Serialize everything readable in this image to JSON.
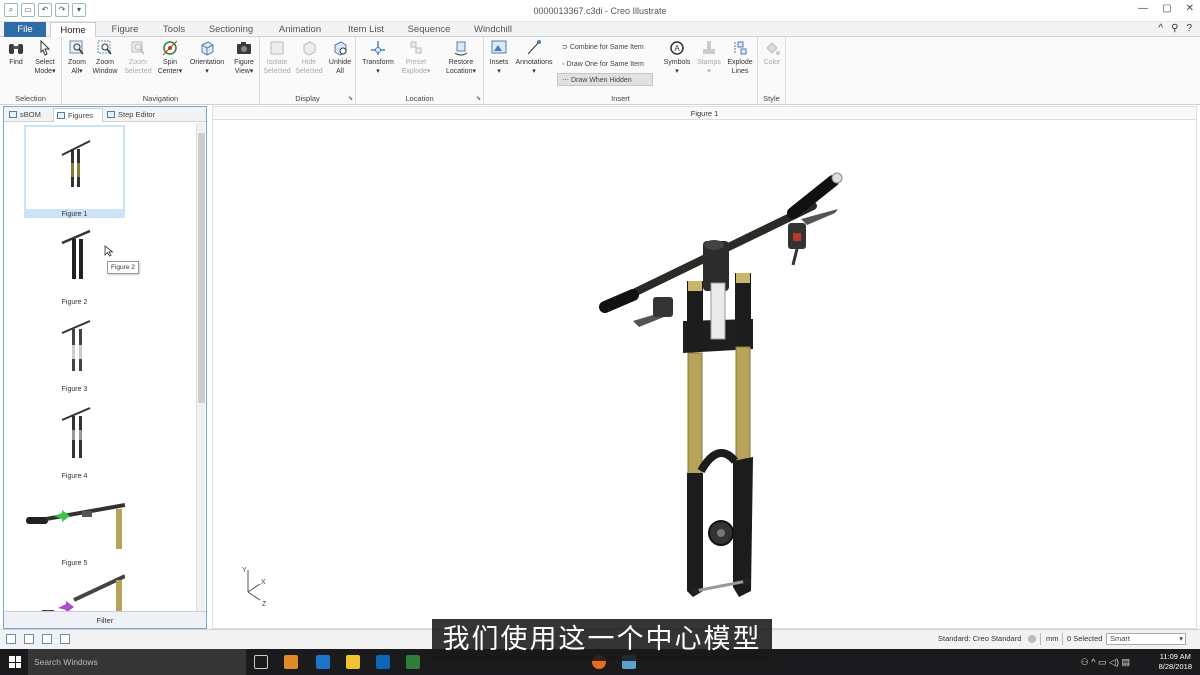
{
  "window": {
    "title": "0000013367.c3di - Creo Illustrate"
  },
  "tabs": [
    "File",
    "Home",
    "Figure",
    "Tools",
    "Sectioning",
    "Animation",
    "Item List",
    "Sequence",
    "Windchill"
  ],
  "ribbon": {
    "selection": {
      "title": "Selection",
      "find": "Find",
      "select": "Select",
      "mode": "Mode"
    },
    "navigation": {
      "title": "Navigation",
      "zoom_all_1": "Zoom",
      "zoom_all_2": "All",
      "zoom_window_1": "Zoom",
      "zoom_window_2": "Window",
      "zoom_selected_1": "Zoom",
      "zoom_selected_2": "Selected",
      "spin_1": "Spin",
      "spin_2": "Center",
      "orientation": "Orientation",
      "figure_view_1": "Figure",
      "figure_view_2": "View"
    },
    "display": {
      "title": "Display",
      "isolate_1": "Isolate",
      "isolate_2": "Selected",
      "hide_1": "Hide",
      "hide_2": "Selected",
      "unhide_1": "Unhide",
      "unhide_2": "All"
    },
    "location": {
      "title": "Location",
      "transform": "Transform",
      "preset_1": "Preset",
      "preset_2": "Explode",
      "restore_1": "Restore",
      "restore_2": "Location"
    },
    "insert": {
      "title": "Insert",
      "insets": "Insets",
      "annotations": "Annotations",
      "combine": "Combine for Same Item",
      "draw_one": "Draw One for Same Item",
      "draw_hidden": "Draw When Hidden",
      "symbols": "Symbols",
      "stamps": "Stamps",
      "explode_1": "Explode",
      "explode_2": "Lines"
    },
    "style": {
      "title": "Style",
      "color": "Color"
    }
  },
  "left_pane": {
    "tabs": [
      "sBOM",
      "Figures",
      "Step Editor"
    ],
    "figures": [
      "Figure 1",
      "Figure 2",
      "Figure 3",
      "Figure 4",
      "Figure 5"
    ],
    "tooltip": "Figure 2",
    "filter": "Filter"
  },
  "viewport": {
    "title": "Figure 1",
    "axis_x": "X",
    "axis_y": "Y",
    "axis_z": "Z"
  },
  "status": {
    "standard": "Standard: Creo Standard",
    "units": "mm",
    "selected": "0 Selected",
    "smart": "Smart"
  },
  "taskbar": {
    "search": "Search Windows",
    "time": "11:09 AM",
    "date": "8/28/2018"
  },
  "subtitle": "我们使用这一个中心模型",
  "colors": {
    "accent": "#2d6ca5",
    "fork_gold": "#b8a35a",
    "selection": "#cde3f7"
  }
}
